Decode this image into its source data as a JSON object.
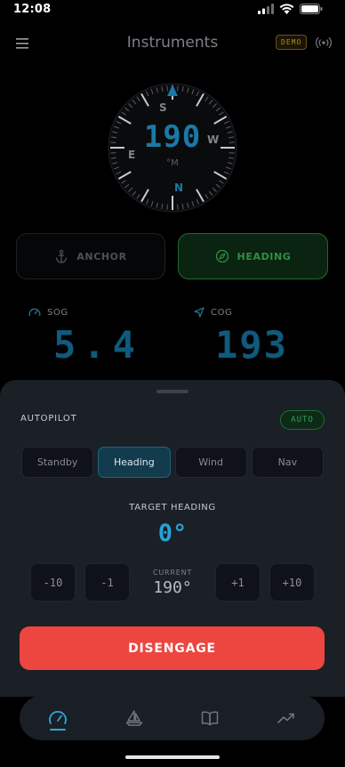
{
  "status_bar": {
    "time": "12:08"
  },
  "header": {
    "title": "Instruments",
    "demo_badge": "DEMO"
  },
  "compass": {
    "heading": "190",
    "unit": "°M",
    "cardinals": {
      "n": "N",
      "s": "S",
      "e": "E",
      "w": "W"
    }
  },
  "modes": {
    "anchor_label": "ANCHOR",
    "heading_label": "HEADING",
    "active": "HEADING"
  },
  "metrics": {
    "sog": {
      "label": "SOG",
      "value": "5.4"
    },
    "cog": {
      "label": "COG",
      "value": "193"
    }
  },
  "autopilot": {
    "title": "AUTOPILOT",
    "status_badge": "AUTO",
    "segments": [
      "Standby",
      "Heading",
      "Wind",
      "Nav"
    ],
    "active_segment": "Heading",
    "target_label": "TARGET HEADING",
    "target_value": "0°",
    "adjust": {
      "minus10": "-10",
      "minus1": "-1",
      "plus1": "+1",
      "plus10": "+10"
    },
    "current_label": "CURRENT",
    "current_value": "190°",
    "disengage_label": "DISENGAGE"
  },
  "tabs": [
    {
      "icon": "gauge-icon",
      "active": true
    },
    {
      "icon": "sailboat-icon",
      "active": false
    },
    {
      "icon": "book-icon",
      "active": false
    },
    {
      "icon": "trend-icon",
      "active": false
    }
  ],
  "colors": {
    "accent": "#25a3d8",
    "heading_mode": "#2f8f45",
    "auto_badge": "#2fa558",
    "demo_badge": "#b88b1e",
    "disengage": "#ed4640"
  }
}
